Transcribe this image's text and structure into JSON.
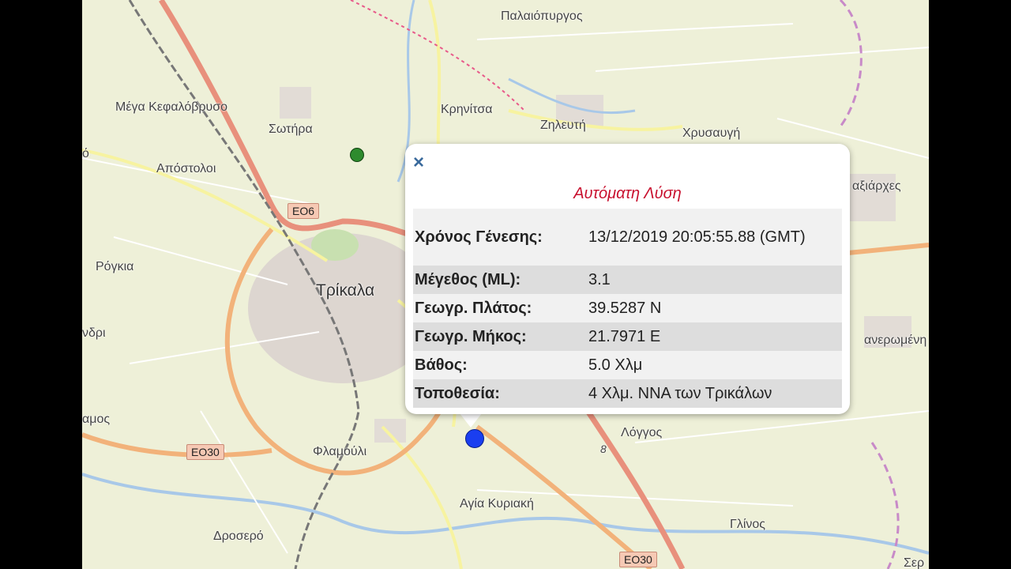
{
  "popup": {
    "close_icon": "close-icon",
    "title": "Αυτόματη Λύση",
    "rows": [
      {
        "key": "Χρόνος Γένεσης:",
        "value": "13/12/2019 20:05:55.88 (GMT)"
      },
      {
        "key": "Μέγεθος (ML):",
        "value": "3.1"
      },
      {
        "key": "Γεωγρ. Πλάτος:",
        "value": "39.5287 N"
      },
      {
        "key": "Γεωγρ. Μήκος:",
        "value": "21.7971 E"
      },
      {
        "key": "Βάθος:",
        "value": "5.0 Χλμ"
      },
      {
        "key": "Τοποθεσία:",
        "value": "4 Χλμ. ΝΝΑ των Τρικάλων"
      }
    ],
    "close_symbol": "×"
  },
  "places": {
    "palaiopyrgos": "Παλαιόπυργος",
    "megakefalovryso": "Μέγα Κεφαλόβρυσο",
    "krinitsa": "Κρηνίτσα",
    "zilefti": "Ζηλευτή",
    "sotira": "Σωτήρα",
    "chrysavgi": "Χρυσαυγή",
    "apostoloi": "Απόστολοι",
    "taxiarches": "αξιάρχες",
    "rogkia": "Ρόγκια",
    "trikala": "Τρίκαλα",
    "vdri": "νδρι",
    "anerwmeni": "ανερωμένη",
    "amos": "αμος",
    "flamouli": "Φλαμούλι",
    "loggos": "Λόγγος",
    "agia_kyriaki": "Αγία Κυριακή",
    "drosero": "Δροσερό",
    "glinos": "Γλίνος",
    "ser": "Σερ",
    "partial_left": "ό"
  },
  "shields": {
    "eo6": "ΕΟ6",
    "eo30_left": "ΕΟ30",
    "eo30_bottom": "ΕΟ30",
    "route8": "8"
  },
  "colors": {
    "title_red": "#c8102e",
    "marker_blue": "#1a3ef0",
    "marker_green": "#2e8b2e"
  }
}
